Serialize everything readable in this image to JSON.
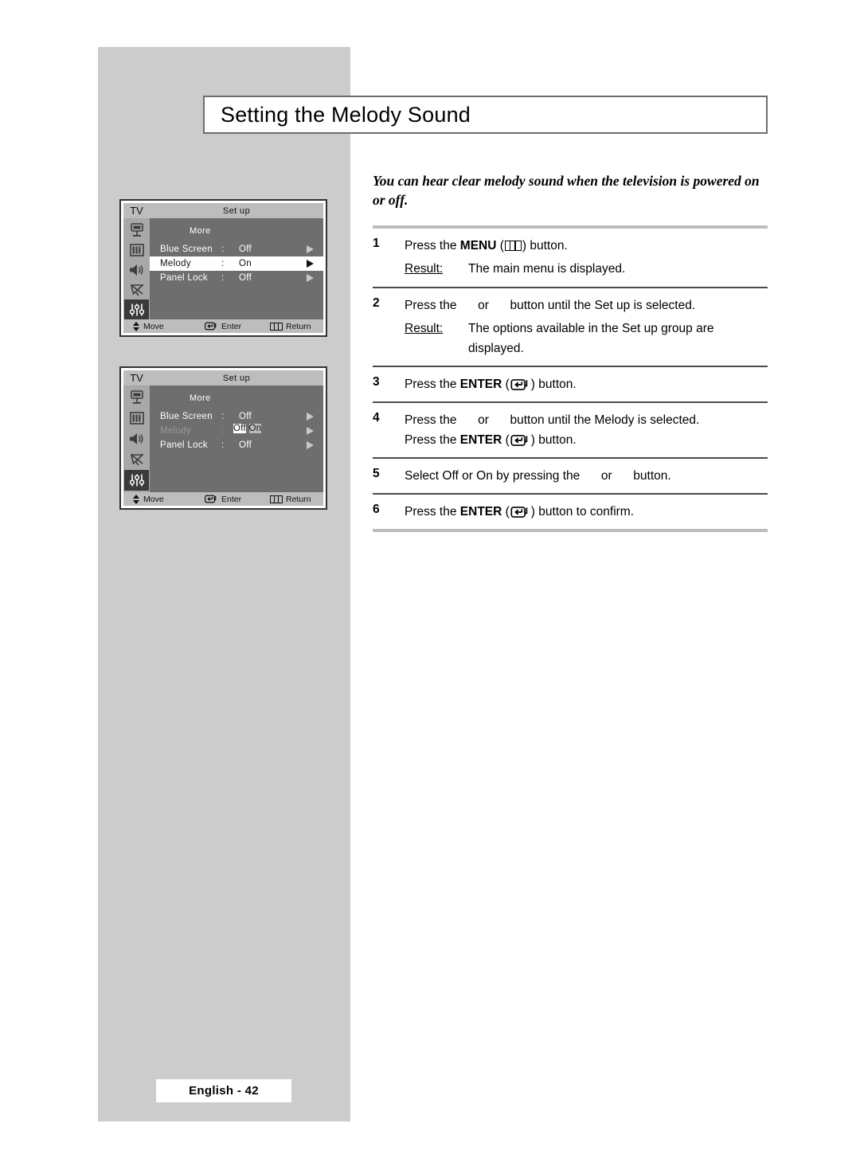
{
  "page": {
    "title": "Setting the Melody Sound",
    "intro": "You can hear clear melody sound when the television is powered on or off.",
    "footer_label": "English - 42",
    "accent_gray": "#cccccc",
    "rule_gray": "#bdbdbd",
    "rule_dark": "#4a4a4a"
  },
  "steps": [
    {
      "num": "1",
      "pre": "Press the ",
      "strong": "MENU",
      "icon": "menu-icon",
      "post": " button.",
      "result_label": "Result:",
      "result_text": "The main menu is displayed."
    },
    {
      "num": "2",
      "pre": "Press the ",
      "mid": " or ",
      "post": " button until the Set up is selected.",
      "result_label": "Result:",
      "result_text": "The options available in the Set up group are displayed."
    },
    {
      "num": "3",
      "pre": "Press the ",
      "strong": "ENTER",
      "icon": "enter-icon",
      "post": " button."
    },
    {
      "num": "4",
      "pre": "Press the ",
      "mid": " or ",
      "post": " button until the Melody is selected.",
      "line2_pre": "Press the ",
      "line2_strong": "ENTER",
      "line2_icon": "enter-icon",
      "line2_post": " button."
    },
    {
      "num": "5",
      "pre": "Select Off or On by pressing the ",
      "mid": " or ",
      "post": " button."
    },
    {
      "num": "6",
      "pre": "Press the ",
      "strong": "ENTER",
      "icon": "enter-icon",
      "post": " button to confirm."
    }
  ],
  "osd": {
    "tv_label": "TV",
    "header_title": "Set up",
    "more_label": "More",
    "rail_icons": [
      "tuner-icon",
      "picture-icon",
      "sound-icon",
      "satellite-icon",
      "setup-icon"
    ],
    "footer": {
      "move": "Move",
      "enter": "Enter",
      "return": "Return"
    },
    "menu_one": {
      "rows": [
        {
          "label": "Blue Screen",
          "colon": ":",
          "value": "Off",
          "selected": false,
          "dimmed": false
        },
        {
          "label": "Melody",
          "colon": ":",
          "value": "On",
          "selected": true,
          "dimmed": false
        },
        {
          "label": "Panel Lock",
          "colon": ":",
          "value": "Off",
          "selected": false,
          "dimmed": false
        }
      ]
    },
    "menu_two": {
      "rows": [
        {
          "label": "Blue Screen",
          "colon": ":",
          "value": "Off",
          "selected": false,
          "dimmed": false
        },
        {
          "label": "Melody",
          "colon": ":",
          "value": "",
          "selected": false,
          "dimmed": true
        },
        {
          "label": "Panel Lock",
          "colon": ":",
          "value": "Off",
          "selected": false,
          "dimmed": false
        }
      ],
      "dropdown": {
        "option_selected": "Off",
        "option_other": "On"
      }
    }
  }
}
